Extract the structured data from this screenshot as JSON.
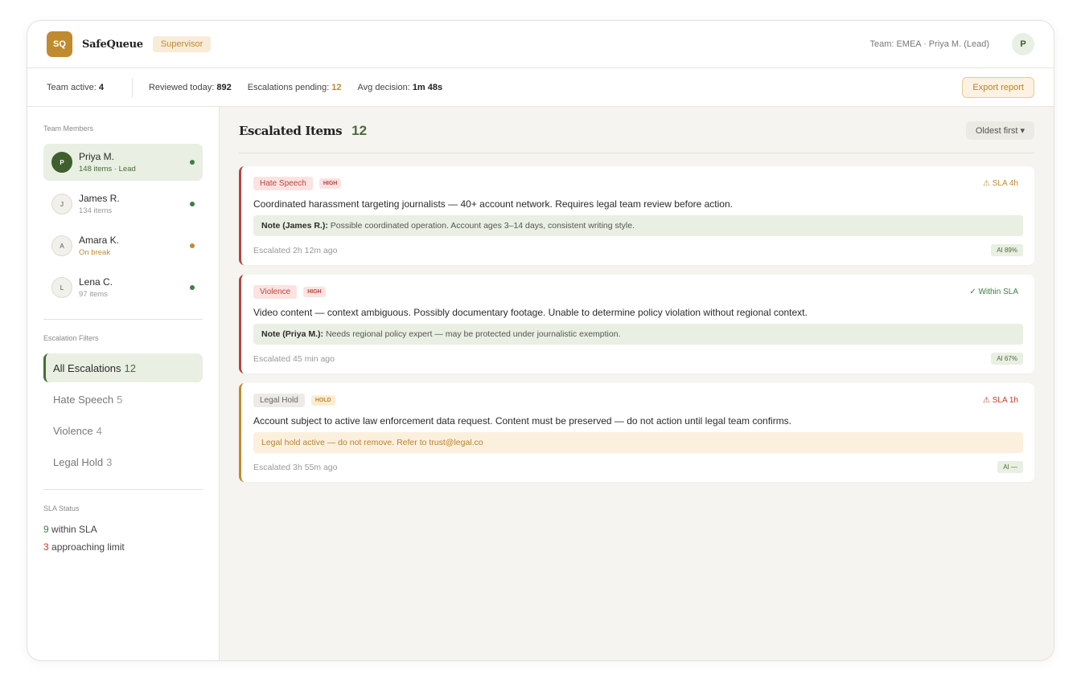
{
  "app": {
    "logo": "SQ",
    "brand": "SafeQueue",
    "role": "Supervisor",
    "team_info": "Team: EMEA · Priya M. (Lead)",
    "user_initial": "P"
  },
  "stats": {
    "team_active_label": "Team active:",
    "team_active_value": "4",
    "reviewed_label": "Reviewed today:",
    "reviewed_value": "892",
    "pending_label": "Escalations pending:",
    "pending_value": "12",
    "avg_label": "Avg decision:",
    "avg_value": "1m 48s",
    "export_label": "Export report"
  },
  "sidebar": {
    "members_title": "Team Members",
    "members": [
      {
        "initial": "P",
        "name": "Priya M.",
        "sub": "148 items · Lead",
        "status": "green"
      },
      {
        "initial": "J",
        "name": "James R.",
        "sub": "134 items",
        "status": "green"
      },
      {
        "initial": "A",
        "name": "Amara K.",
        "sub": "On break",
        "status": "amber"
      },
      {
        "initial": "L",
        "name": "Lena C.",
        "sub": "97 items",
        "status": "green"
      }
    ],
    "filters_title": "Escalation Filters",
    "filters": [
      {
        "label": "All Escalations",
        "count": "12"
      },
      {
        "label": "Hate Speech",
        "count": "5"
      },
      {
        "label": "Violence",
        "count": "4"
      },
      {
        "label": "Legal Hold",
        "count": "3"
      }
    ],
    "sla_title": "SLA Status",
    "sla_within_count": "9",
    "sla_within_label": "within SLA",
    "sla_approach_count": "3",
    "sla_approach_label": "approaching limit"
  },
  "main": {
    "title": "Escalated Items",
    "count": "12",
    "sort_label": "Oldest first ▾",
    "cards": [
      {
        "category": "Hate Speech",
        "severity": "HIGH",
        "sla": "⚠ SLA 4h",
        "text": "Coordinated harassment targeting journalists — 40+ account network. Requires legal team review before action.",
        "note_author": "Note (James R.):",
        "note_text": "Possible coordinated operation. Account ages 3–14 days, consistent writing style.",
        "escalated": "Escalated 2h 12m ago",
        "ai": "AI 89%"
      },
      {
        "category": "Violence",
        "severity": "HIGH",
        "sla": "✓ Within SLA",
        "text": "Video content — context ambiguous. Possibly documentary footage. Unable to determine policy violation without regional context.",
        "note_author": "Note (Priya M.):",
        "note_text": "Needs regional policy expert — may be protected under journalistic exemption.",
        "escalated": "Escalated 45 min ago",
        "ai": "AI 67%"
      },
      {
        "category": "Legal Hold",
        "severity": "HOLD",
        "sla": "⚠ SLA 1h",
        "text": "Account subject to active law enforcement data request. Content must be preserved — do not action until legal team confirms.",
        "note_text": "Legal hold active — do not remove. Refer to trust@legal.co",
        "escalated": "Escalated 3h 55m ago",
        "ai": "AI —"
      }
    ]
  },
  "colors": {
    "accent_green": "#4b6b38",
    "accent_amber": "#c08a2f",
    "danger_red": "#b8443f",
    "main_bg": "#f5f4f0"
  }
}
